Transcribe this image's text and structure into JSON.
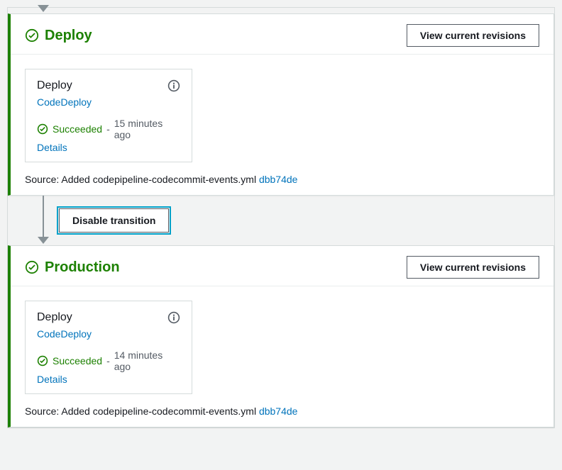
{
  "buttons": {
    "view_revisions": "View current revisions",
    "disable_transition": "Disable transition"
  },
  "stages": [
    {
      "name": "Deploy",
      "action": {
        "title": "Deploy",
        "provider": "CodeDeploy",
        "status": "Succeeded",
        "sep": "-",
        "time": "15 minutes ago",
        "details": "Details"
      },
      "source_prefix": "Source: Added codepipeline-codecommit-events.yml ",
      "commit": "dbb74de"
    },
    {
      "name": "Production",
      "action": {
        "title": "Deploy",
        "provider": "CodeDeploy",
        "status": "Succeeded",
        "sep": "-",
        "time": "14 minutes ago",
        "details": "Details"
      },
      "source_prefix": "Source: Added codepipeline-codecommit-events.yml ",
      "commit": "dbb74de"
    }
  ]
}
